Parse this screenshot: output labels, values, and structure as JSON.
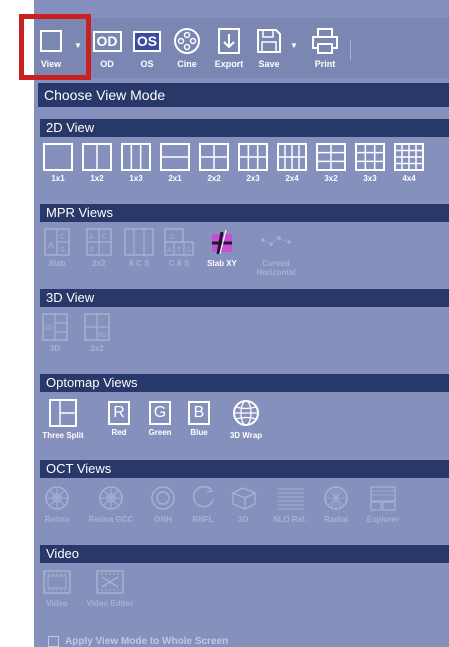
{
  "toolbar": {
    "view": "View",
    "od": "OD",
    "os": "OS",
    "cine": "Cine",
    "export": "Export",
    "save": "Save",
    "print": "Print",
    "od_icon_text": "OD",
    "os_icon_text": "OS"
  },
  "panel": {
    "title": "Choose View Mode"
  },
  "sections": {
    "view2d": {
      "title": "2D View",
      "items": [
        "1x1",
        "1x2",
        "1x3",
        "2x1",
        "2x2",
        "2x3",
        "2x4",
        "3x2",
        "3x3",
        "4x4"
      ]
    },
    "mpr": {
      "title": "MPR Views",
      "items": [
        "Slab",
        "2x2",
        "A C S",
        "C A S",
        "Slab XY",
        "Curved\nHorizontal"
      ]
    },
    "view3d": {
      "title": "3D View",
      "items": [
        "3D",
        "2x2"
      ]
    },
    "optomap": {
      "title": "Optomap Views",
      "items": [
        "Three Split",
        "Red",
        "Green",
        "Blue",
        "3D Wrap"
      ],
      "letters": [
        "R",
        "G",
        "B"
      ]
    },
    "oct": {
      "title": "OCT Views",
      "items": [
        "Retina",
        "Retina GCC",
        "ONH",
        "RNFL",
        "3D",
        "SLO Ref.",
        "Radial",
        "Explorer"
      ]
    },
    "video": {
      "title": "Video",
      "items": [
        "Video",
        "Video Editor"
      ]
    }
  },
  "apply_checkbox": {
    "label": "Apply View Mode to Whole Screen",
    "checked": false
  },
  "colors": {
    "panel_bg": "#8590bd",
    "header_bg": "#283868",
    "highlight": "#c8211f",
    "selected": "#3b4ba0"
  }
}
